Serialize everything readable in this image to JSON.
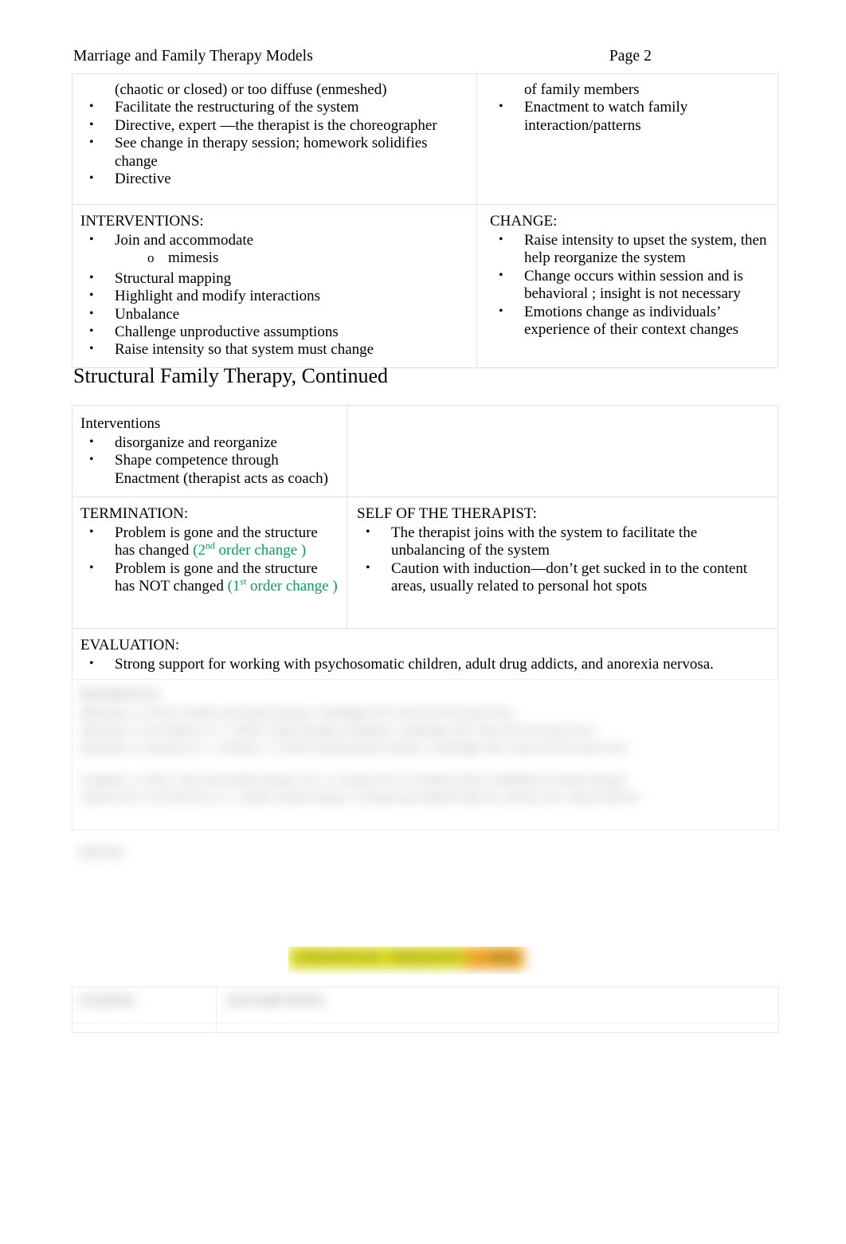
{
  "header": {
    "title": "Marriage and Family Therapy Models",
    "page_label": "Page 2"
  },
  "colors": {
    "green_text": "#0aa05a",
    "highlight_yellow": "#d8d817",
    "highlight_orange": "#f5a623",
    "table_border": "#e2e2e2"
  },
  "table_top": {
    "left_cell_top": {
      "continuation_line": "(chaotic or closed) or too diffuse (enmeshed)",
      "bullets": [
        "Facilitate the restructuring of the system",
        "Directive, expert  —the therapist is the choreographer",
        "See change in therapy session; homework solidifies change",
        "Directive"
      ]
    },
    "right_cell_top": {
      "continuation_line": "of family members",
      "bullets": [
        "Enactment  to watch family interaction/patterns"
      ]
    },
    "left_cell_interventions": {
      "label": "INTERVENTIONS:",
      "bullets": [
        "Join and accommodate",
        "Structural mapping",
        "Highlight and modify interactions",
        "Unbalance",
        "Challenge unproductive assumptions",
        "Raise intensity so that system must change"
      ],
      "sub_bullet": "mimesis"
    },
    "right_cell_change": {
      "label": "CHANGE:",
      "bullets": [
        "Raise intensity  to upset the system, then help reorganize the system",
        "Change occurs within session and is behavioral ; insight is not necessary",
        "Emotions change as individuals’ experience of their context changes"
      ]
    }
  },
  "section_heading": "Structural Family Therapy, Continued",
  "table_bottom": {
    "interventions_cell": {
      "label": "Interventions",
      "bullets": [
        "disorganize and reorganize",
        "Shape competence through Enactment   (therapist acts as coach)"
      ]
    },
    "empty_cell": "",
    "termination_cell": {
      "label": "TERMINATION:",
      "bullets": [
        {
          "text_before": "Problem is gone and the structure has changed ",
          "green_prefix": "(2",
          "green_superscript": "nd",
          "green_suffix": " order change  )"
        },
        {
          "text_before": "Problem is gone and the structure has NOT changed ",
          "green_prefix": "(1",
          "green_superscript": "st",
          "green_suffix": " order change  )"
        }
      ]
    },
    "self_of_therapist_cell": {
      "label": "SELF OF THE THERAPIST:",
      "bullets": [
        "The therapist joins with the system    to facilitate the unbalancing of the system",
        "Caution with induction—don’t get sucked in to the content areas, usually related to personal hot spots"
      ]
    },
    "evaluation_cell": {
      "label": "EVALUATION:",
      "bullets": [
        "Strong support for working with psychosomatic children, adult drug addicts, and anorexia nervosa."
      ]
    }
  },
  "redacted": {
    "note": "These regions are blurred/illegible in the source image.",
    "references_label": "REFERENCES",
    "references_lines": [
      "Minuchin, S. (1974). Families and family therapy. Cambridge, MA: Harvard University Press.",
      "Minuchin, S., & Fishman, H. C. (1981). Family therapy techniques. Cambridge, MA: Harvard University Press.",
      "Minuchin, S., Rosman, B. L., & Baker, L. (1978). Psychosomatic families. Cambridge, MA: Harvard University Press.",
      "Colapinto, J. (1991). Structural family therapy. In A. S. Gurman & D. P. Kniskern (Eds.), Handbook of family therapy.",
      "Nichols, M. P., & Schwartz, R. C. (2004). Family therapy: Concepts and methods (6th ed.). Boston, MA: Allyn & Bacon."
    ],
    "notes_label": "NOTES",
    "banner_title": "STRATEGIC THERAPY — MRI",
    "bottom_table_header_left": "SCHOOL",
    "bottom_table_header_right": "ASSUMPTIONS"
  }
}
